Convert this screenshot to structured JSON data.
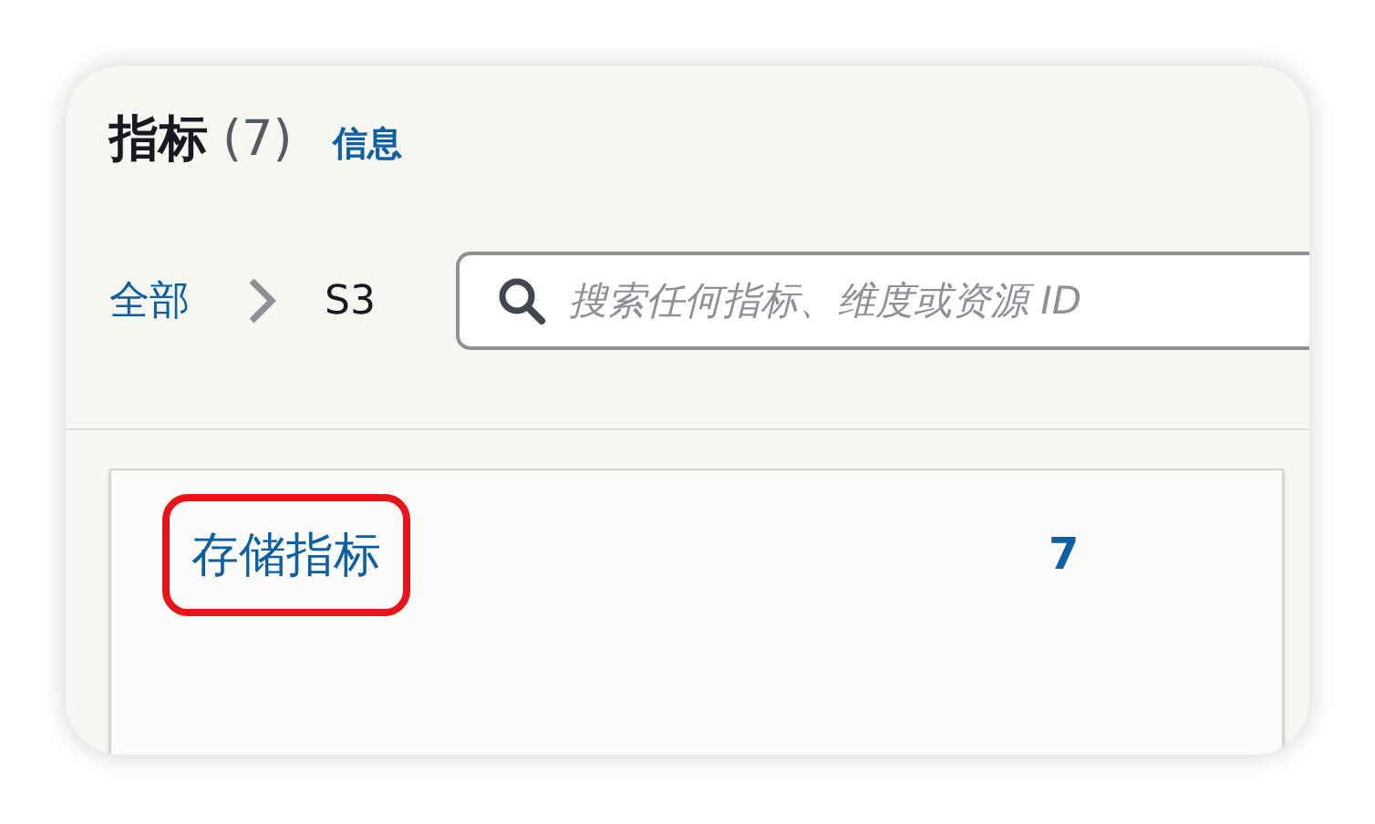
{
  "header": {
    "title": "指标",
    "count": "(7)",
    "info_link": "信息"
  },
  "breadcrumb": [
    {
      "label": "全部",
      "kind": "link"
    },
    {
      "label": "S3",
      "kind": "current"
    }
  ],
  "search": {
    "placeholder": "搜索任何指标、维度或资源 ID"
  },
  "categories": [
    {
      "label": "存储指标",
      "count": "7",
      "highlighted": true
    }
  ]
}
